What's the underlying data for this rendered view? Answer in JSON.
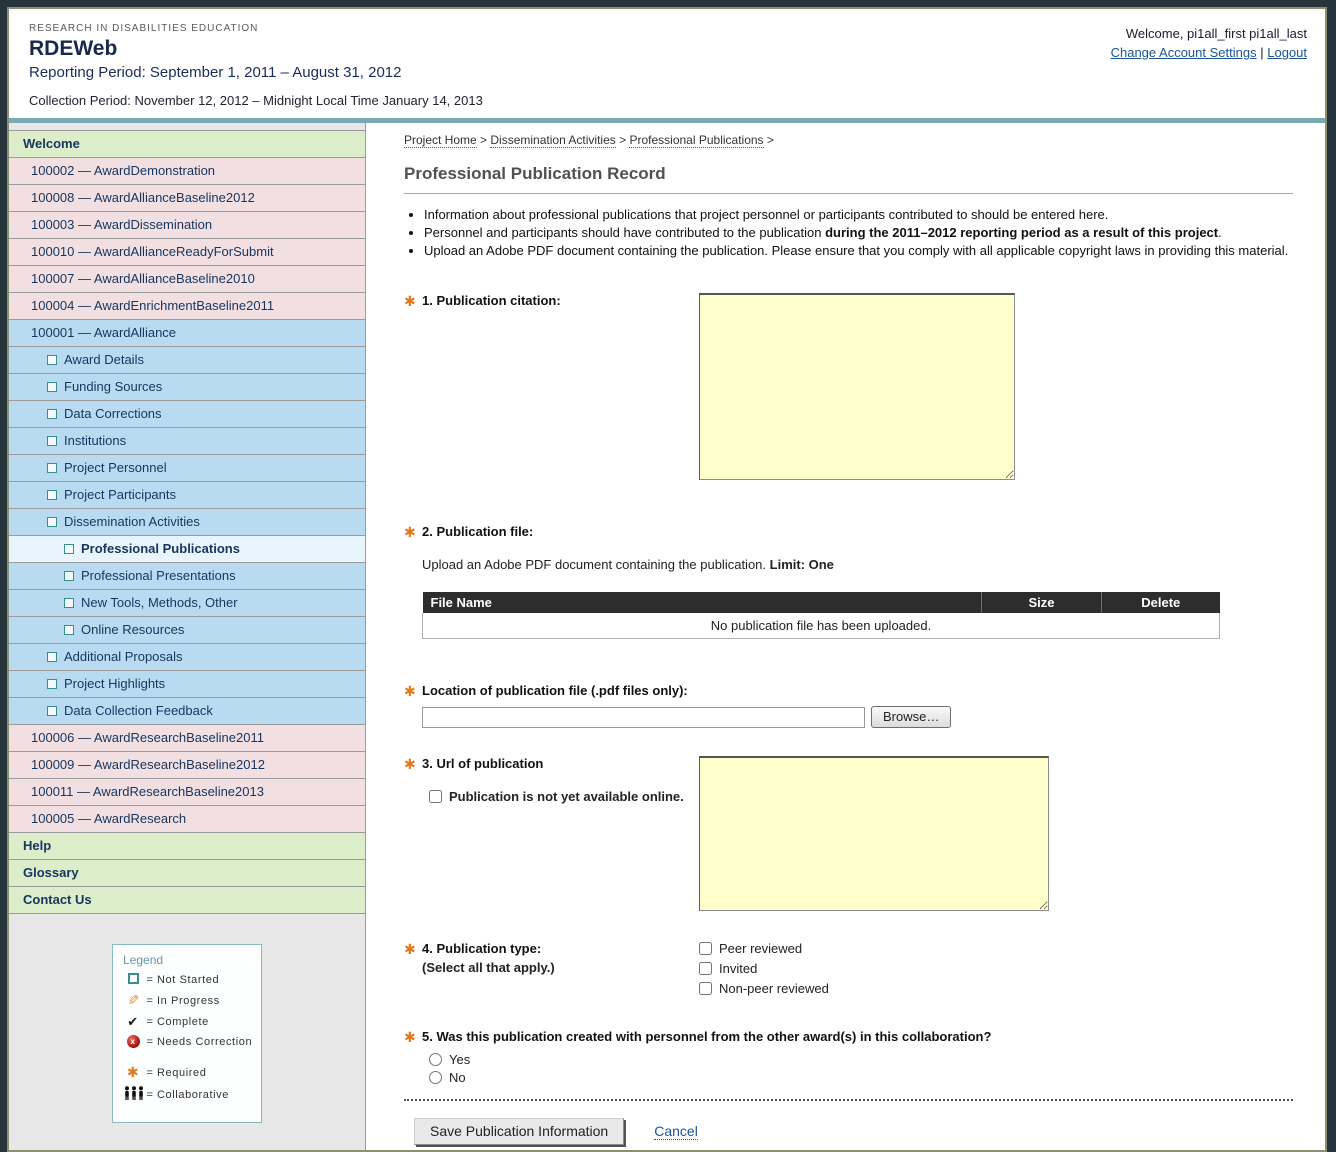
{
  "header": {
    "org": "RESEARCH IN DISABILITIES EDUCATION",
    "app": "RDEWeb",
    "reporting": "Reporting Period: September 1, 2011 – August 31, 2012",
    "collection": "Collection Period: November 12, 2012 – Midnight Local Time January 14, 2013",
    "welcome": "Welcome, pi1all_first pi1all_last",
    "account_link": "Change Account Settings",
    "divider": "|",
    "logout_link": "Logout"
  },
  "colors": {
    "frame_outer": "#26343c",
    "frame_border_olive": "#8d9070",
    "teal_band": "#7aa9b3",
    "sidebar_green": "#dcedca",
    "sidebar_pink": "#f1dfe1",
    "sidebar_blue": "#b9dbf2",
    "sidebar_selected": "#e9f5fc",
    "nav_text": "#17355e",
    "link_blue": "#1b5593",
    "asterisk_orange": "#e07a1e",
    "textarea_yellow": "#ffffcc",
    "table_header_bg": "#2d2d2d"
  },
  "sidebar": {
    "nav": [
      {
        "label": "Welcome",
        "kind": "top-green"
      },
      {
        "label": "100002 — AwardDemonstration",
        "kind": "award-pink"
      },
      {
        "label": "100008 — AwardAllianceBaseline2012",
        "kind": "award-pink"
      },
      {
        "label": "100003 — AwardDissemination",
        "kind": "award-pink"
      },
      {
        "label": "100010 — AwardAllianceReadyForSubmit",
        "kind": "award-pink"
      },
      {
        "label": "100007 — AwardAllianceBaseline2010",
        "kind": "award-pink"
      },
      {
        "label": "100004 — AwardEnrichmentBaseline2011",
        "kind": "award-pink"
      },
      {
        "label": "100001 — AwardAlliance",
        "kind": "award-blue"
      },
      {
        "label": "Award Details",
        "kind": "sub",
        "icon": "not-started"
      },
      {
        "label": "Funding Sources",
        "kind": "sub",
        "icon": "not-started"
      },
      {
        "label": "Data Corrections",
        "kind": "sub",
        "icon": "not-started"
      },
      {
        "label": "Institutions",
        "kind": "sub",
        "icon": "not-started"
      },
      {
        "label": "Project Personnel",
        "kind": "sub",
        "icon": "not-started"
      },
      {
        "label": "Project Participants",
        "kind": "sub",
        "icon": "not-started"
      },
      {
        "label": "Dissemination Activities",
        "kind": "sub",
        "icon": "not-started"
      },
      {
        "label": "Professional Publications",
        "kind": "subsub",
        "icon": "not-started",
        "selected": true
      },
      {
        "label": "Professional Presentations",
        "kind": "subsub",
        "icon": "not-started"
      },
      {
        "label": "New Tools, Methods, Other",
        "kind": "subsub",
        "icon": "not-started"
      },
      {
        "label": "Online Resources",
        "kind": "subsub",
        "icon": "not-started"
      },
      {
        "label": "Additional Proposals",
        "kind": "sub",
        "icon": "not-started"
      },
      {
        "label": "Project Highlights",
        "kind": "sub",
        "icon": "not-started"
      },
      {
        "label": "Data Collection Feedback",
        "kind": "sub",
        "icon": "not-started"
      },
      {
        "label": "100006 — AwardResearchBaseline2011",
        "kind": "award-pink"
      },
      {
        "label": "100009 — AwardResearchBaseline2012",
        "kind": "award-pink"
      },
      {
        "label": "100011 — AwardResearchBaseline2013",
        "kind": "award-pink"
      },
      {
        "label": "100005 — AwardResearch",
        "kind": "award-pink"
      },
      {
        "label": "Help",
        "kind": "top-green"
      },
      {
        "label": "Glossary",
        "kind": "top-green"
      },
      {
        "label": "Contact Us",
        "kind": "top-green"
      }
    ],
    "legend": {
      "title": "Legend",
      "items": [
        {
          "icon": "not-started",
          "text": "Not Started"
        },
        {
          "icon": "in-progress",
          "text": "In Progress"
        },
        {
          "icon": "complete",
          "text": "Complete"
        },
        {
          "icon": "needs-correction",
          "text": "Needs Correction"
        },
        {
          "icon": "required",
          "text": "Required",
          "spaced": true
        },
        {
          "icon": "collaborative",
          "text": "Collaborative"
        }
      ]
    }
  },
  "breadcrumb": [
    "Project Home",
    "Dissemination Activities",
    "Professional Publications"
  ],
  "main": {
    "title": "Professional Publication Record",
    "bullets": [
      [
        {
          "t": "Information about professional publications that project personnel or participants contributed to should be entered here."
        }
      ],
      [
        {
          "t": "Personnel and participants should have contributed to the publication "
        },
        {
          "t": "during the 2011–2012 reporting period as a result of this project",
          "b": true
        },
        {
          "t": "."
        }
      ],
      [
        {
          "t": "Upload an Adobe PDF document containing the publication. Please ensure that you comply with all applicable copyright laws in providing this material."
        }
      ]
    ],
    "q1_label": "1. Publication citation:",
    "q2_label": "2. Publication file:",
    "q2_help": "Upload an Adobe PDF document containing the publication.",
    "q2_limit": "Limit: One",
    "file_table": {
      "headers": [
        "File Name",
        "Size",
        "Delete"
      ],
      "empty": "No publication file has been uploaded."
    },
    "location_label": "Location of publication file (.pdf files only):",
    "location_value": "",
    "browse_button": "Browse…",
    "q3_label": "3. Url of publication",
    "q3_checkbox": "Publication is not yet available online.",
    "q4_label": "4. Publication type:",
    "q4_sub": "(Select all that apply.)",
    "q4_options": [
      "Peer reviewed",
      "Invited",
      "Non-peer reviewed"
    ],
    "q5_label": "5. Was this publication created with personnel from the other award(s) in this collaboration?",
    "q5_options": [
      "Yes",
      "No"
    ],
    "save_button": "Save Publication Information",
    "cancel_link": "Cancel"
  }
}
